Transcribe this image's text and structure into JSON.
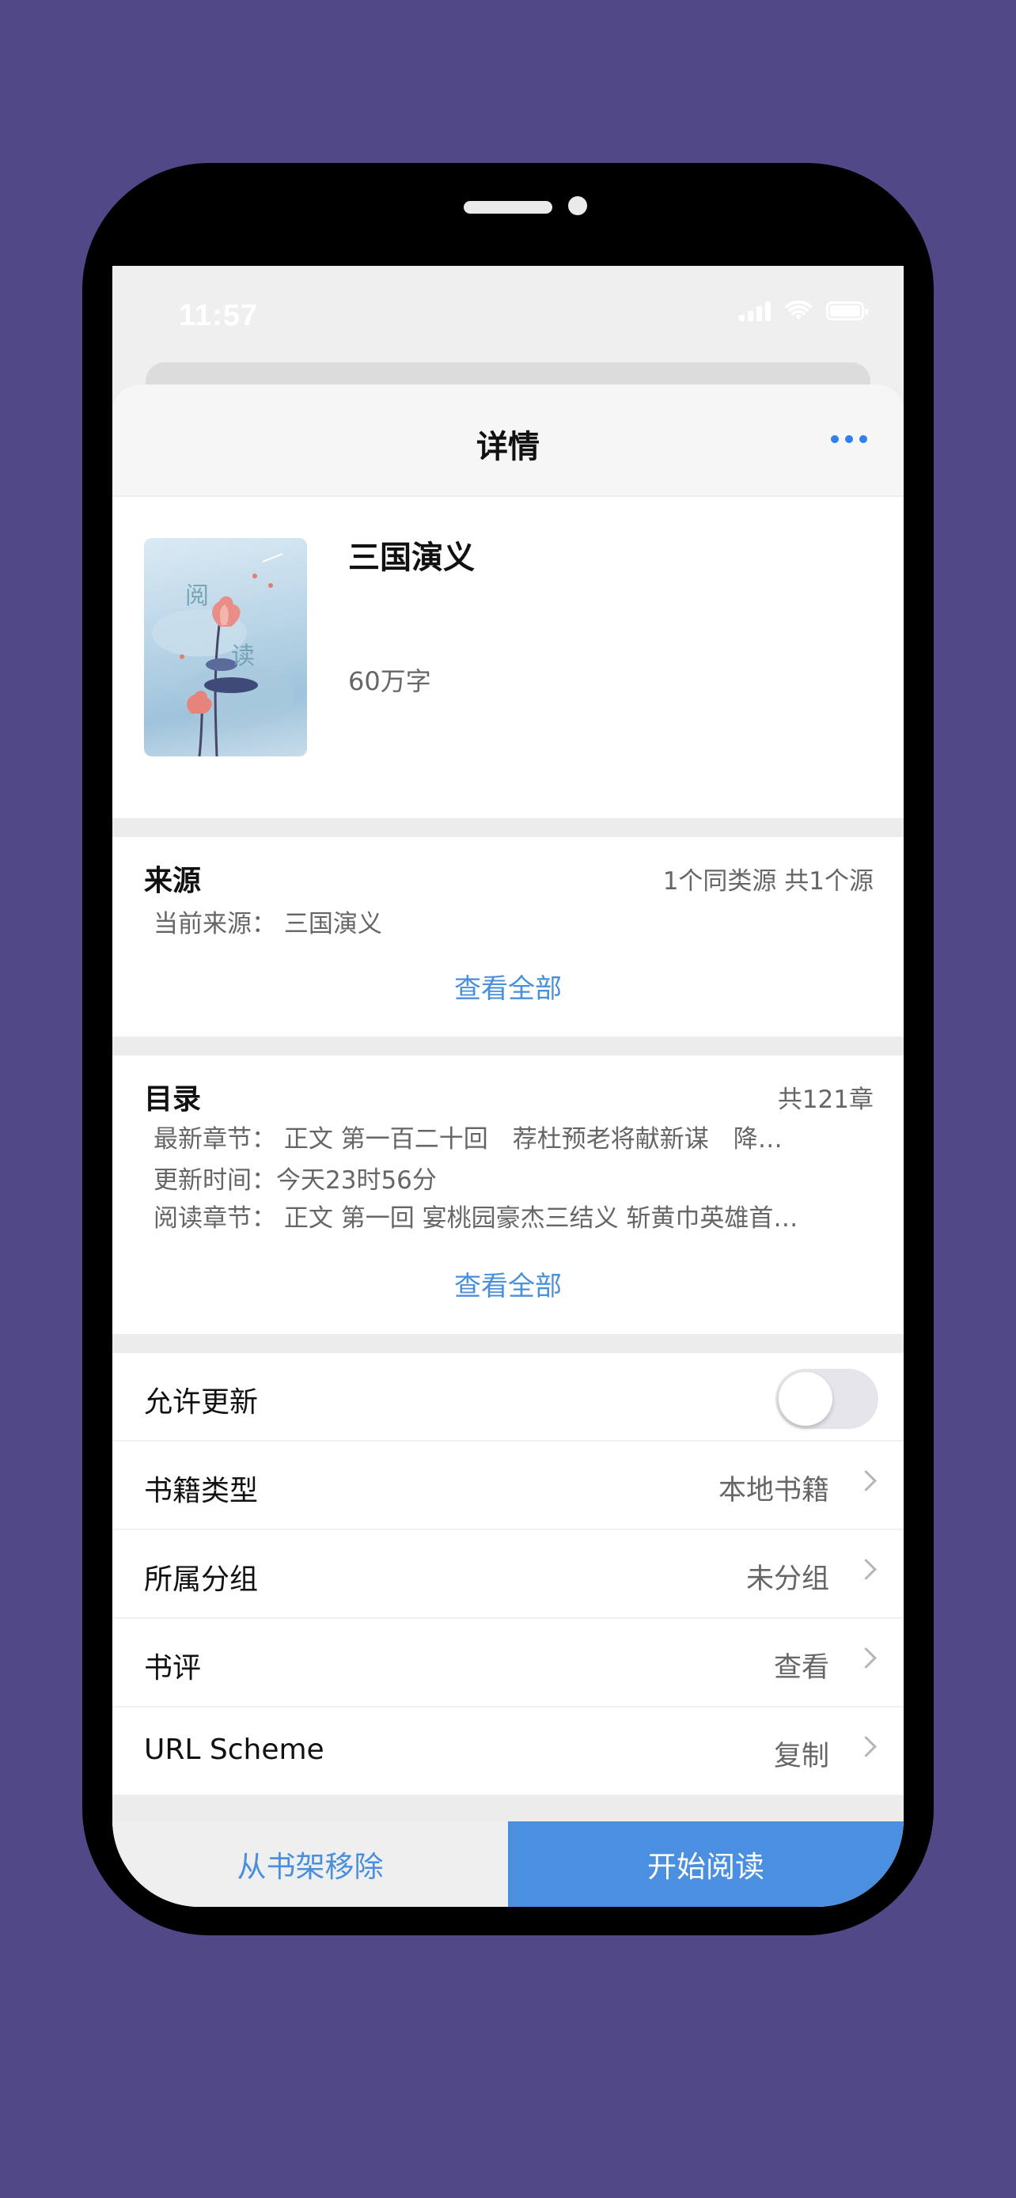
{
  "status_bar": {
    "time": "11:57"
  },
  "nav": {
    "title": "详情",
    "more_icon": "ellipsis-icon"
  },
  "book": {
    "cover_chars": [
      "阅",
      "读"
    ],
    "title": "三国演义",
    "words": "60万字"
  },
  "source": {
    "title": "来源",
    "summary": "1个同类源 共1个源",
    "current_label": "当前来源：",
    "current_value": "三国演义",
    "view_all": "查看全部"
  },
  "toc": {
    "title": "目录",
    "count": "共121章",
    "latest_label": "最新章节：",
    "latest_value": "正文 第一百二十回　荐杜预老将献新谋　降…",
    "updated_label": "更新时间：",
    "updated_value": "今天23时56分",
    "reading_label": "阅读章节：",
    "reading_value": "正文 第一回 宴桃园豪杰三结义 斩黄巾英雄首…",
    "view_all": "查看全部"
  },
  "settings": {
    "allow_update": {
      "label": "允许更新",
      "enabled": false
    },
    "book_type": {
      "label": "书籍类型",
      "value": "本地书籍"
    },
    "group": {
      "label": "所属分组",
      "value": "未分组"
    },
    "review": {
      "label": "书评",
      "value": "查看"
    },
    "url_scheme": {
      "label": "URL Scheme",
      "value": "复制"
    }
  },
  "actions": {
    "remove": "从书架移除",
    "start_read": "开始阅读"
  },
  "colors": {
    "background": "#514987",
    "accent": "#4a8fdc",
    "primary_button": "#4a8fe0"
  }
}
